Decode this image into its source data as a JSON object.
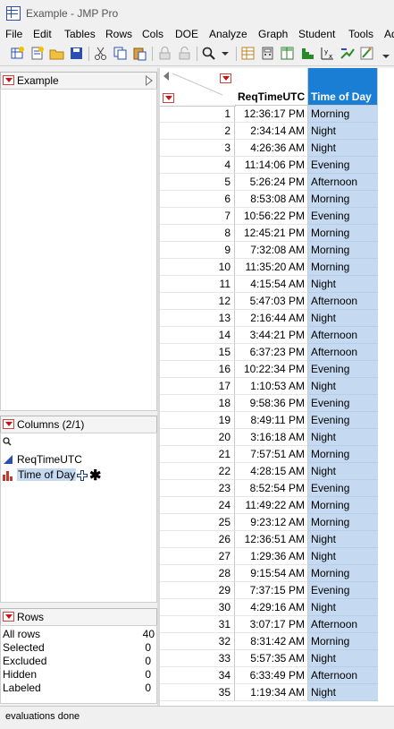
{
  "window": {
    "title": "Example - JMP Pro"
  },
  "menu": [
    "File",
    "Edit",
    "Tables",
    "Rows",
    "Cols",
    "DOE",
    "Analyze",
    "Graph",
    "Student",
    "Tools",
    "Ad"
  ],
  "toolbar": [
    "new-data-table-icon",
    "new-script-icon",
    "open-icon",
    "save-icon",
    "cut-icon",
    "copy-icon",
    "paste-icon",
    "lock-icon",
    "unlock-icon",
    "search-icon",
    "dropdown-icon",
    "data-grid-icon",
    "calculator-icon",
    "tabulate-icon",
    "distribution-icon",
    "fit-y-by-x-icon",
    "fit-model-icon",
    "graph-builder-icon",
    "overflow-icon"
  ],
  "table_panel": {
    "title": "Example"
  },
  "columns_panel": {
    "title": "Columns (2/1)",
    "search_placeholder": "",
    "columns": [
      {
        "name": "ReqTimeUTC",
        "icon": "continuous-icon",
        "selected": false
      },
      {
        "name": "Time of Day",
        "icon": "nominal-bar-icon",
        "selected": true
      }
    ]
  },
  "rows_panel": {
    "title": "Rows",
    "stats": [
      {
        "label": "All rows",
        "value": "40"
      },
      {
        "label": "Selected",
        "value": "0"
      },
      {
        "label": "Excluded",
        "value": "0"
      },
      {
        "label": "Hidden",
        "value": "0"
      },
      {
        "label": "Labeled",
        "value": "0"
      }
    ]
  },
  "grid": {
    "headers": [
      "ReqTimeUTC",
      "Time of Day"
    ],
    "rows": [
      [
        "1",
        "12:36:17 PM",
        "Morning"
      ],
      [
        "2",
        "2:34:14 AM",
        "Night"
      ],
      [
        "3",
        "4:26:36 AM",
        "Night"
      ],
      [
        "4",
        "11:14:06 PM",
        "Evening"
      ],
      [
        "5",
        "5:26:24 PM",
        "Afternoon"
      ],
      [
        "6",
        "8:53:08 AM",
        "Morning"
      ],
      [
        "7",
        "10:56:22 PM",
        "Evening"
      ],
      [
        "8",
        "12:45:21 PM",
        "Morning"
      ],
      [
        "9",
        "7:32:08 AM",
        "Morning"
      ],
      [
        "10",
        "11:35:20 AM",
        "Morning"
      ],
      [
        "11",
        "4:15:54 AM",
        "Night"
      ],
      [
        "12",
        "5:47:03 PM",
        "Afternoon"
      ],
      [
        "13",
        "2:16:44 AM",
        "Night"
      ],
      [
        "14",
        "3:44:21 PM",
        "Afternoon"
      ],
      [
        "15",
        "6:37:23 PM",
        "Afternoon"
      ],
      [
        "16",
        "10:22:34 PM",
        "Evening"
      ],
      [
        "17",
        "1:10:53 AM",
        "Night"
      ],
      [
        "18",
        "9:58:36 PM",
        "Evening"
      ],
      [
        "19",
        "8:49:11 PM",
        "Evening"
      ],
      [
        "20",
        "3:16:18 AM",
        "Night"
      ],
      [
        "21",
        "7:57:51 AM",
        "Morning"
      ],
      [
        "22",
        "4:28:15 AM",
        "Night"
      ],
      [
        "23",
        "8:52:54 PM",
        "Evening"
      ],
      [
        "24",
        "11:49:22 AM",
        "Morning"
      ],
      [
        "25",
        "9:23:12 AM",
        "Morning"
      ],
      [
        "26",
        "12:36:51 AM",
        "Night"
      ],
      [
        "27",
        "1:29:36 AM",
        "Night"
      ],
      [
        "28",
        "9:15:54 AM",
        "Morning"
      ],
      [
        "29",
        "7:37:15 PM",
        "Evening"
      ],
      [
        "30",
        "4:29:16 AM",
        "Night"
      ],
      [
        "31",
        "3:07:17 PM",
        "Afternoon"
      ],
      [
        "32",
        "8:31:42 AM",
        "Morning"
      ],
      [
        "33",
        "5:57:35 AM",
        "Night"
      ],
      [
        "34",
        "6:33:49 PM",
        "Afternoon"
      ],
      [
        "35",
        "1:19:34 AM",
        "Night"
      ]
    ]
  },
  "status": {
    "text": "evaluations done"
  },
  "colors": {
    "selected_column": "#c5daf0",
    "header_selected": "#1a7fd4",
    "red_triangle": "#d01010"
  }
}
